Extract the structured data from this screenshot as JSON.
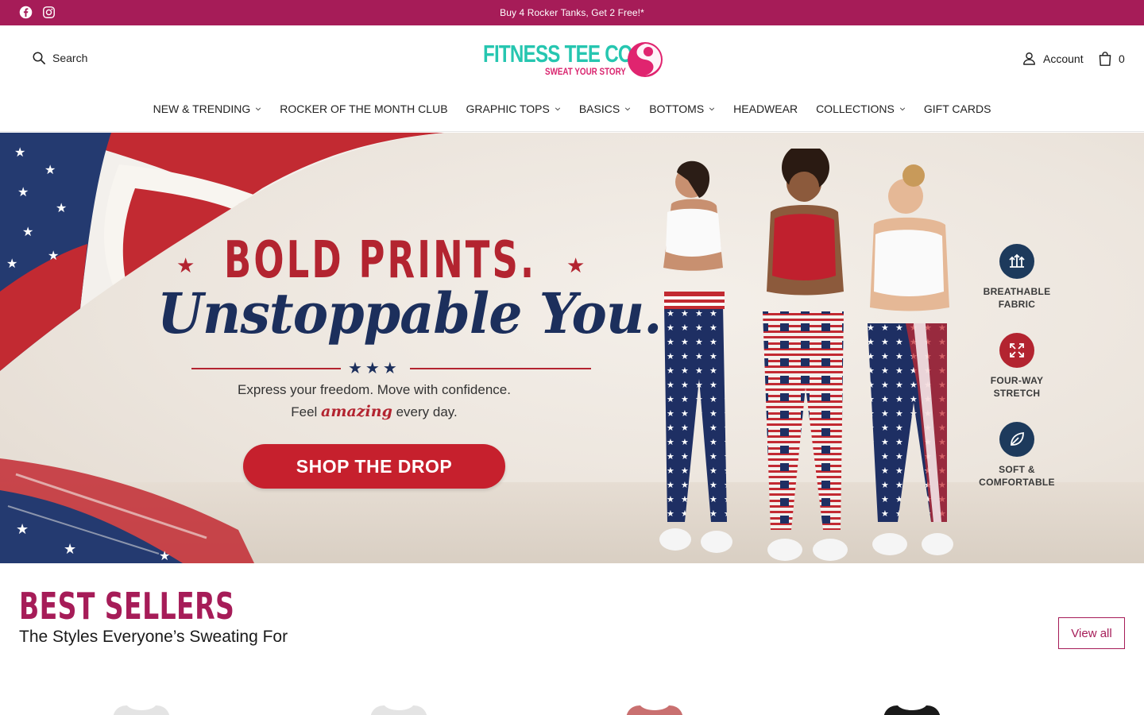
{
  "announcement": {
    "text": "Buy 4 Rocker Tanks, Get 2 Free!*",
    "social_icons": [
      "facebook-icon",
      "instagram-icon"
    ]
  },
  "header": {
    "search_label": "Search",
    "logo_line1": "FITNESS TEE CO",
    "logo_line2": "SWEAT YOUR STORY",
    "account_label": "Account",
    "cart_count": "0"
  },
  "nav": {
    "items": [
      {
        "label": "NEW & TRENDING",
        "dropdown": true
      },
      {
        "label": "ROCKER OF THE MONTH CLUB",
        "dropdown": false
      },
      {
        "label": "GRAPHIC TOPS",
        "dropdown": true
      },
      {
        "label": "BASICS",
        "dropdown": true
      },
      {
        "label": "BOTTOMS",
        "dropdown": true
      },
      {
        "label": "HEADWEAR",
        "dropdown": false
      },
      {
        "label": "COLLECTIONS",
        "dropdown": true
      },
      {
        "label": "GIFT CARDS",
        "dropdown": false
      }
    ]
  },
  "hero": {
    "headline": "BOLD PRINTS.",
    "script_line": "Unstoppable You.",
    "tagline1": "Express your freedom. Move with confidence.",
    "tagline2_pre": "Feel ",
    "tagline2_em": "amazing",
    "tagline2_post": " every day.",
    "cta_label": "SHOP THE DROP",
    "features": [
      {
        "line1": "BREATHABLE",
        "line2": "FABRIC",
        "icon": "breathable-icon"
      },
      {
        "line1": "FOUR-WAY",
        "line2": "STRETCH",
        "icon": "stretch-icon"
      },
      {
        "line1": "SOFT &",
        "line2": "COMFORTABLE",
        "icon": "leaf-icon"
      }
    ]
  },
  "best_sellers": {
    "title": "BEST SELLERS",
    "subtitle": "The Styles Everyone’s Sweating For",
    "view_all": "View all"
  },
  "colors": {
    "brand": "#a61c58",
    "cta_red": "#c6202d",
    "navy": "#1c2f5c",
    "teal": "#26c6b0"
  }
}
